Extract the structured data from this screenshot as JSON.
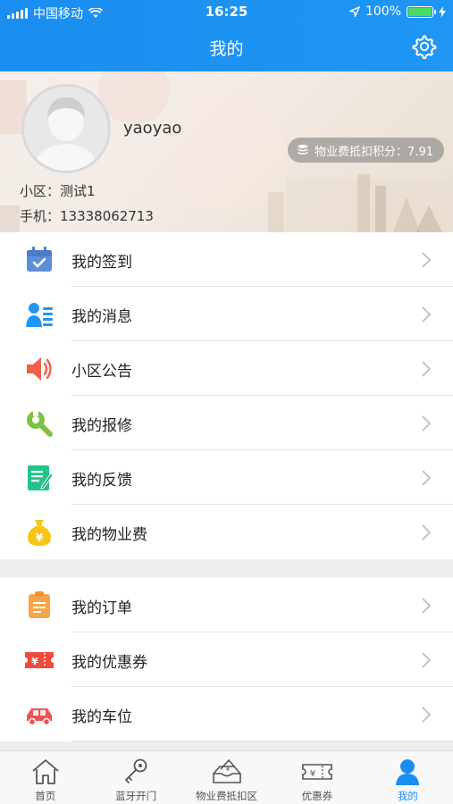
{
  "status_bar": {
    "carrier": "中国移动",
    "time": "16:25",
    "battery": "100%"
  },
  "header": {
    "title": "我的",
    "settings_icon": "gear-icon"
  },
  "profile": {
    "username": "yaoyao",
    "points_label": "物业费抵扣积分：7.91",
    "community": "小区：测试1",
    "phone": "手机：13338062713"
  },
  "menu_group_1": [
    {
      "label": "我的签到",
      "icon": "calendar-check-icon",
      "color": "#5b8fd6"
    },
    {
      "label": "我的消息",
      "icon": "contact-card-icon",
      "color": "#2196f3"
    },
    {
      "label": "小区公告",
      "icon": "speaker-icon",
      "color": "#f0604a"
    },
    {
      "label": "我的报修",
      "icon": "wrench-icon",
      "color": "#7cc242"
    },
    {
      "label": "我的反馈",
      "icon": "feedback-note-icon",
      "color": "#22c48a"
    },
    {
      "label": "我的物业费",
      "icon": "money-bag-icon",
      "color": "#f5c517"
    }
  ],
  "menu_group_2": [
    {
      "label": "我的订单",
      "icon": "order-clipboard-icon",
      "color": "#f7a54a"
    },
    {
      "label": "我的优惠券",
      "icon": "coupon-icon",
      "color": "#ee4b3c"
    },
    {
      "label": "我的车位",
      "icon": "car-icon",
      "color": "#ef5350"
    }
  ],
  "tabbar": {
    "tabs": [
      {
        "label": "首页",
        "icon": "home-icon",
        "active": false
      },
      {
        "label": "蓝牙开门",
        "icon": "key-icon",
        "active": false
      },
      {
        "label": "物业费抵扣区",
        "icon": "money-tray-icon",
        "active": false
      },
      {
        "label": "优惠券",
        "icon": "ticket-icon",
        "active": false
      },
      {
        "label": "我的",
        "icon": "user-icon",
        "active": true
      }
    ]
  },
  "colors": {
    "header_blue": "#1a8ef0",
    "active_tab": "#1a8ef0"
  }
}
